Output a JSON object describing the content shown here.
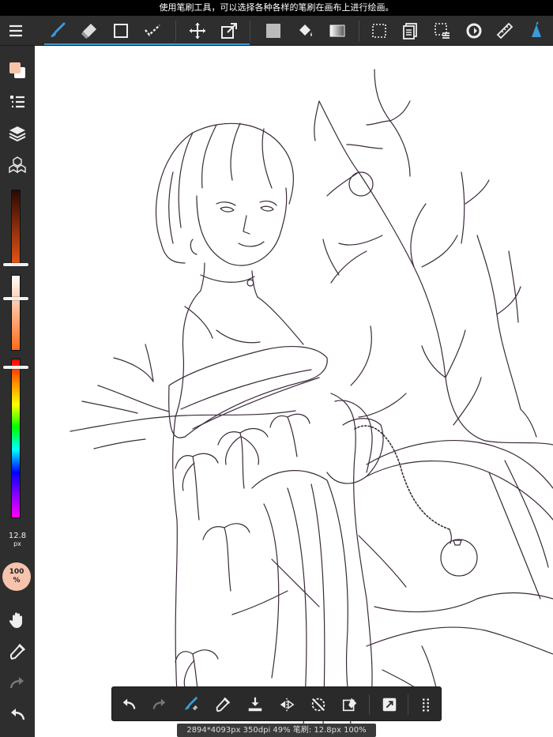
{
  "hint_bar": {
    "text": "使用笔刷工具，可以选择各种各样的笔刷在画布上进行绘画。"
  },
  "toolbar": {
    "items": [
      {
        "name": "menu-icon"
      },
      {
        "name": "brush-tool-icon",
        "selected": true
      },
      {
        "name": "eraser-tool-icon"
      },
      {
        "name": "shape-tool-icon"
      },
      {
        "name": "selection-pen-icon"
      },
      {
        "name": "move-tool-icon"
      },
      {
        "name": "transform-tool-icon"
      },
      {
        "name": "fill-color-swatch-icon"
      },
      {
        "name": "bucket-fill-icon"
      },
      {
        "name": "gradient-icon"
      },
      {
        "name": "select-rectangle-icon"
      },
      {
        "name": "copy-layer-icon"
      },
      {
        "name": "select-menu-icon"
      },
      {
        "name": "rotate-canvas-icon"
      },
      {
        "name": "ruler-icon"
      },
      {
        "name": "text-tool-icon"
      }
    ],
    "accent": "#3a9bd8"
  },
  "sidebar": {
    "items": [
      {
        "name": "color-swatch-icon"
      },
      {
        "name": "brush-list-icon"
      },
      {
        "name": "layers-icon"
      },
      {
        "name": "materials-icon"
      }
    ],
    "brush_size": {
      "value": "12.8",
      "unit": "px"
    },
    "opacity": {
      "value": "100",
      "unit": "%"
    },
    "bottom_items": [
      {
        "name": "hand-tool-icon"
      },
      {
        "name": "eyedropper-icon"
      },
      {
        "name": "redo-icon"
      },
      {
        "name": "undo-icon"
      }
    ]
  },
  "bottom_bar": {
    "items": [
      {
        "name": "undo-icon"
      },
      {
        "name": "redo-icon"
      },
      {
        "name": "brush-eraser-toggle-icon"
      },
      {
        "name": "eyedropper-icon"
      },
      {
        "name": "import-icon"
      },
      {
        "name": "flip-icon"
      },
      {
        "name": "snap-off-icon"
      },
      {
        "name": "clear-layer-icon"
      },
      {
        "name": "expand-icon"
      },
      {
        "name": "more-grid-icon"
      }
    ]
  },
  "status_bar": {
    "text": "2894*4093px 350dpi 49% 笔刷: 12.8px 100%"
  }
}
